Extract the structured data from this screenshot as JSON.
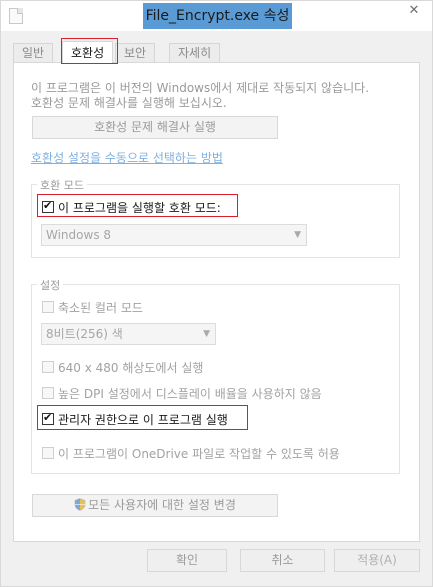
{
  "window": {
    "title": "File_Encrypt.exe 속성",
    "close_glyph": "✕"
  },
  "tabs": [
    {
      "label": "일반",
      "active": false
    },
    {
      "label": "호환성",
      "active": true
    },
    {
      "label": "보안",
      "active": false
    },
    {
      "label": "자세히",
      "active": false
    }
  ],
  "panel": {
    "info_line1": "이 프로그램은 이 버전의 Windows에서 제대로 작동되지 않습니다.",
    "info_line2": "호환성 문제 해결사를 실행해 보십시오.",
    "troubleshooter_button": "호환성 문제 해결사 실행",
    "manual_link": "호환성 설정을 수동으로 선택하는 방법",
    "compat_mode": {
      "group_label": "호환 모드",
      "checkbox_label": "이 프로그램을 실행할 호환 모드:",
      "checked": true,
      "selected_os": "Windows 8"
    },
    "settings": {
      "group_label": "설정",
      "reduced_color_label": "축소된 컬러 모드",
      "reduced_color_checked": false,
      "color_depth_value": "8비트(256) 색",
      "res_640_label": "640 x 480 해상도에서 실행",
      "res_640_checked": false,
      "high_dpi_label": "높은 DPI 설정에서 디스플레이 배율을 사용하지 않음",
      "high_dpi_checked": false,
      "run_as_admin_label": "관리자 권한으로 이 프로그램 실행",
      "run_as_admin_checked": true,
      "onedrive_label": "이 프로그램이 OneDrive 파일로 작업할 수 있도록 허용",
      "onedrive_checked": false
    },
    "all_users_button": "모든 사용자에 대한 설정 변경"
  },
  "footer": {
    "ok_label": "확인",
    "cancel_label": "취소",
    "apply_label": "적용(A)"
  },
  "colors": {
    "title_highlight": "#5b9bd5",
    "annotation_red": "#d9202a",
    "link_blue": "#7eb0e0"
  },
  "icons": {
    "app": "file-icon",
    "close": "close-icon",
    "shield": "uac-shield-icon",
    "dropdown": "chevron-down-icon"
  }
}
